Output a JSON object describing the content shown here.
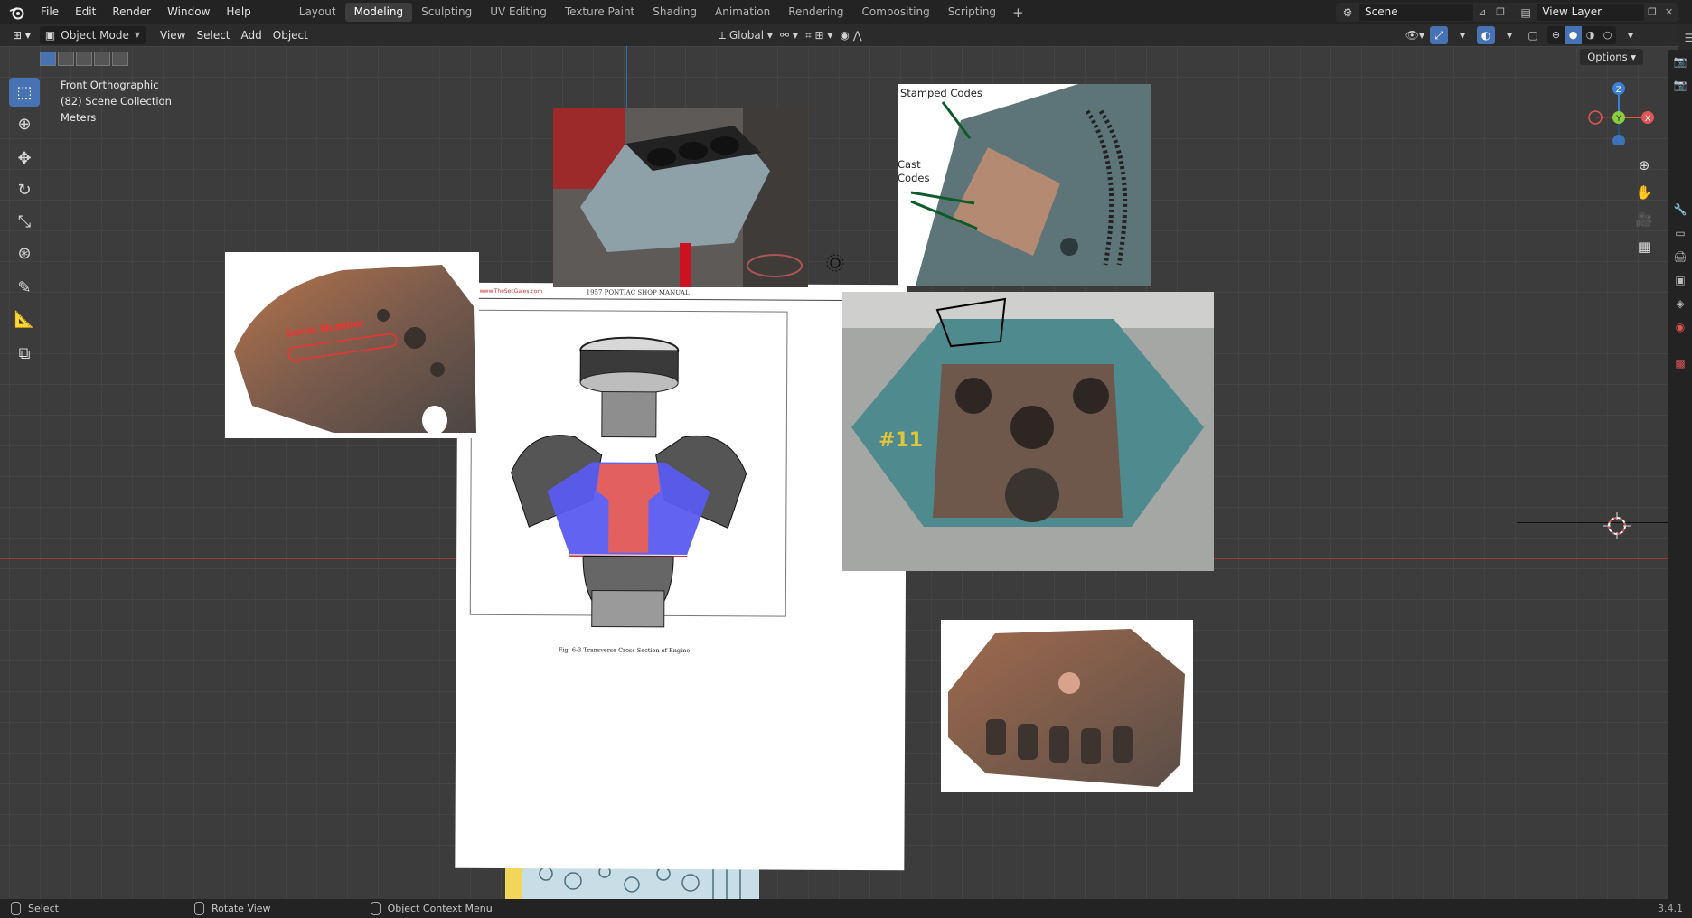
{
  "app": {
    "logo_icon": "blender-logo-icon",
    "menus": [
      "File",
      "Edit",
      "Render",
      "Window",
      "Help"
    ],
    "workspaces": [
      "Layout",
      "Modeling",
      "Sculpting",
      "UV Editing",
      "Texture Paint",
      "Shading",
      "Animation",
      "Rendering",
      "Compositing",
      "Scripting"
    ],
    "active_workspace": "Modeling",
    "add_workspace": "+",
    "scene": "Scene",
    "view_layer": "View Layer"
  },
  "header": {
    "mode": "Object Mode",
    "menus": [
      "View",
      "Select",
      "Add",
      "Object"
    ],
    "orientation": "Global",
    "options": "Options"
  },
  "viewport": {
    "view_name": "Front Orthographic",
    "collection": "(82) Scene Collection",
    "units": "Meters"
  },
  "references": {
    "img1_labels": [
      "Serial Number"
    ],
    "img2_labels": [
      "Stamped Codes",
      "Cast",
      "Codes"
    ],
    "img3_small_header": "1957 PONTIAC SHOP MANUAL",
    "img3_small_left": "www.TheSecGales.com",
    "img3_caption": "Fig. 6-3 Transverse Cross Section of Engine",
    "badge": "#11"
  },
  "axis_labels": {
    "z": "Z",
    "y": "Y",
    "x": "X"
  },
  "status": {
    "select": "Select",
    "rotate": "Rotate View",
    "context": "Object Context Menu",
    "version": "3.4.1"
  },
  "colors": {
    "accent": "#4772b3",
    "x_axis": "#e25555",
    "y_axis": "#8bcc3d",
    "z_axis": "#3e7fd6"
  }
}
